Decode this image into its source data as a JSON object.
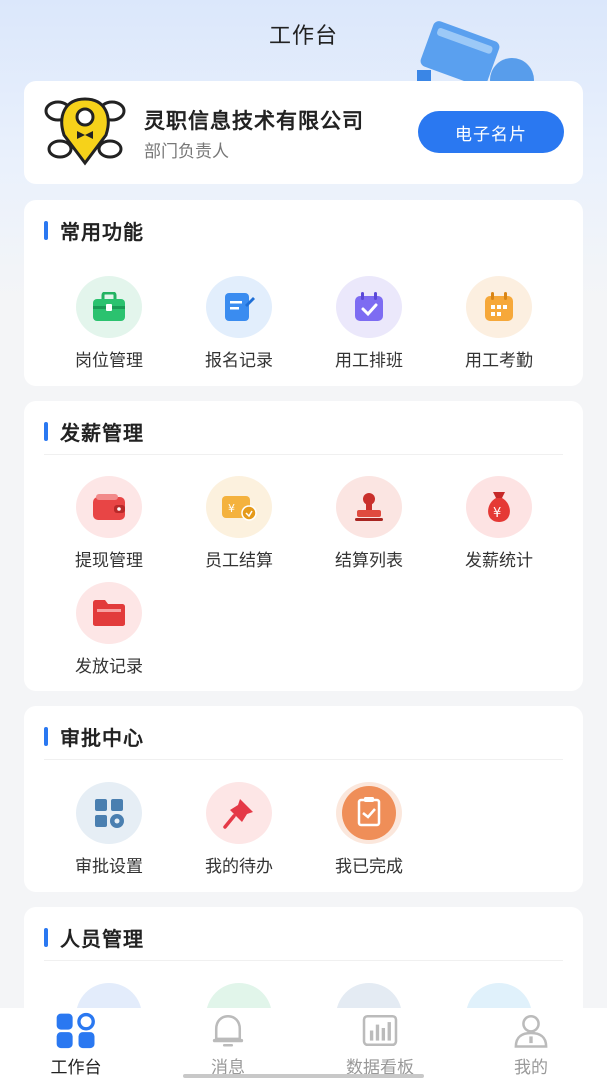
{
  "header": {
    "title": "工作台"
  },
  "company": {
    "name": "灵职信息技术有限公司",
    "role": "部门负责人",
    "button_label": "电子名片"
  },
  "sections": [
    {
      "title": "常用功能",
      "items": [
        {
          "label": "岗位管理",
          "icon": "briefcase-icon"
        },
        {
          "label": "报名记录",
          "icon": "edit-form-icon"
        },
        {
          "label": "用工排班",
          "icon": "calendar-check-icon"
        },
        {
          "label": "用工考勤",
          "icon": "calendar-grid-icon"
        }
      ]
    },
    {
      "title": "发薪管理",
      "items": [
        {
          "label": "提现管理",
          "icon": "wallet-icon"
        },
        {
          "label": "员工结算",
          "icon": "payment-card-icon"
        },
        {
          "label": "结算列表",
          "icon": "stamp-icon"
        },
        {
          "label": "发薪统计",
          "icon": "money-bag-icon"
        },
        {
          "label": "发放记录",
          "icon": "folder-icon"
        }
      ]
    },
    {
      "title": "审批中心",
      "items": [
        {
          "label": "审批设置",
          "icon": "grid-settings-icon"
        },
        {
          "label": "我的待办",
          "icon": "pin-icon"
        },
        {
          "label": "我已完成",
          "icon": "clipboard-check-icon"
        }
      ]
    },
    {
      "title": "人员管理",
      "items": []
    }
  ],
  "tabbar": {
    "items": [
      {
        "label": "工作台",
        "icon": "workbench-icon",
        "active": true
      },
      {
        "label": "消息",
        "icon": "bell-icon",
        "active": false
      },
      {
        "label": "数据看板",
        "icon": "bar-chart-icon",
        "active": false
      },
      {
        "label": "我的",
        "icon": "user-icon",
        "active": false
      }
    ]
  },
  "colors": {
    "accent": "#2a78f1",
    "background": "#f4f5f7",
    "card": "#ffffff"
  }
}
